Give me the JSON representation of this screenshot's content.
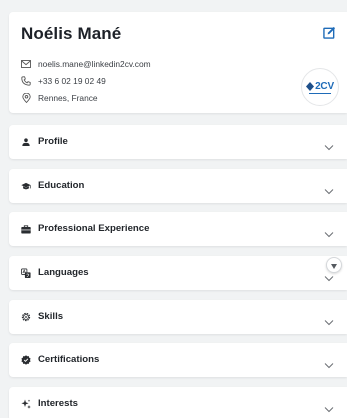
{
  "profile": {
    "name": "Noélis Mané",
    "email": "noelis.mane@linkedin2cv.com",
    "phone": "+33 6 02 19 02 49",
    "location": "Rennes, France",
    "logo_text": "2CV",
    "icons": {
      "edit": "edit-icon",
      "email": "mail-icon",
      "phone": "phone-icon",
      "location": "location-pin-icon",
      "logo": "linkedin2cv-logo"
    }
  },
  "sections": [
    {
      "label": "Profile",
      "icon": "person-icon"
    },
    {
      "label": "Education",
      "icon": "graduation-cap-icon"
    },
    {
      "label": "Professional Experience",
      "icon": "briefcase-icon"
    },
    {
      "label": "Languages",
      "icon": "translate-icon"
    },
    {
      "label": "Skills",
      "icon": "gear-icon"
    },
    {
      "label": "Certifications",
      "icon": "badge-check-icon"
    },
    {
      "label": "Interests",
      "icon": "sparkle-icon"
    }
  ],
  "colors": {
    "accent": "#1e6bb8",
    "text": "#1d2128",
    "background": "#f1f3f4",
    "card": "#ffffff"
  }
}
